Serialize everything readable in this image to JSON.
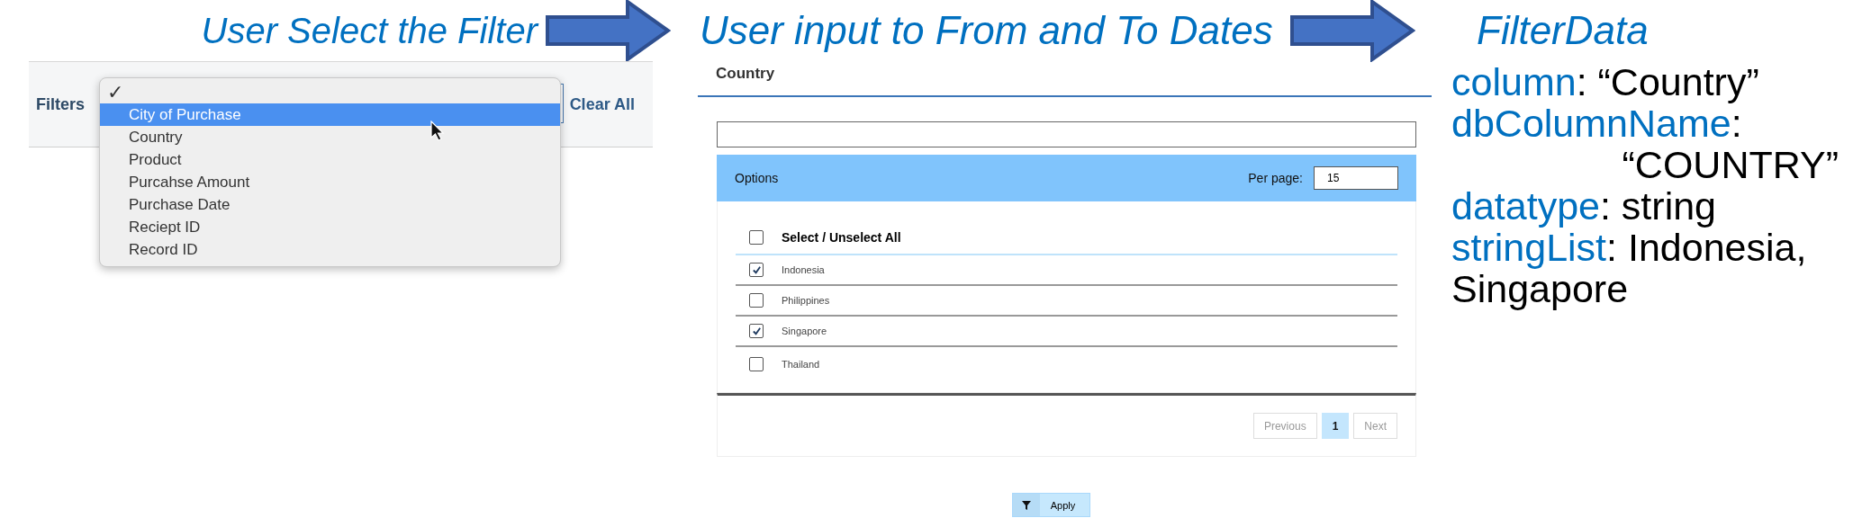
{
  "steps": [
    {
      "title": "User Select the Filter"
    },
    {
      "title": "User input to From and To Dates"
    },
    {
      "title": "FilterData"
    }
  ],
  "filter_bar": {
    "label": "Filters",
    "action": "Clear All",
    "menu": {
      "check": "✓",
      "items": [
        {
          "label": "City of Purchase",
          "selected": true
        },
        {
          "label": "Country",
          "selected": false
        },
        {
          "label": "Product",
          "selected": false
        },
        {
          "label": "Purcahse Amount",
          "selected": false
        },
        {
          "label": "Purchase Date",
          "selected": false
        },
        {
          "label": "Reciept ID",
          "selected": false
        },
        {
          "label": "Record ID",
          "selected": false
        }
      ]
    }
  },
  "country_panel": {
    "title": "Country",
    "options_label": "Options",
    "per_page_label": "Per page:",
    "per_page_value": "15",
    "select_all": {
      "label": "Select / Unselect All",
      "checked": false
    },
    "rows": [
      {
        "label": "Indonesia",
        "checked": true
      },
      {
        "label": "Philippines",
        "checked": false
      },
      {
        "label": "Singapore",
        "checked": true
      },
      {
        "label": "Thailand",
        "checked": false
      }
    ],
    "pagination": {
      "previous": "Previous",
      "pages": [
        {
          "label": "1",
          "selected": true
        }
      ],
      "next": "Next"
    },
    "apply": "Apply"
  },
  "filter_data": {
    "lines": [
      {
        "key": "column",
        "value": ": “Country”"
      },
      {
        "key": "dbColumnName",
        "value": ":",
        "continuation": {
          "text": "“COUNTRY”",
          "kind": "indented"
        }
      },
      {
        "key": "datatype",
        "value": ": string"
      },
      {
        "key": "stringList",
        "value": ":  Indonesia,",
        "continuation": {
          "text": "Singapore",
          "kind": "wrapped"
        }
      }
    ]
  }
}
